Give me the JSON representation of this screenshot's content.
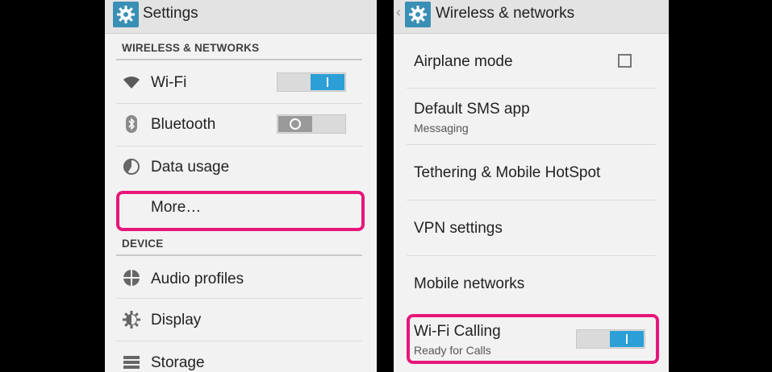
{
  "colors": {
    "accent": "#2b9fd6",
    "highlight": "#e6177a",
    "actionbar_icon_bg": "#3a8fb5"
  },
  "left": {
    "title": "Settings",
    "title_icon": "gear-icon",
    "sections": {
      "wireless": "WIRELESS & NETWORKS",
      "device": "DEVICE"
    },
    "items": {
      "wifi": {
        "label": "Wi-Fi",
        "icon": "wifi-icon",
        "toggle": "on"
      },
      "bluetooth": {
        "label": "Bluetooth",
        "icon": "bluetooth-icon",
        "toggle": "off"
      },
      "data_usage": {
        "label": "Data usage",
        "icon": "data-usage-icon"
      },
      "more": {
        "label": "More…",
        "highlighted": true
      },
      "audio": {
        "label": "Audio profiles",
        "icon": "audio-profiles-icon"
      },
      "display": {
        "label": "Display",
        "icon": "display-brightness-icon"
      },
      "storage": {
        "label": "Storage",
        "icon": "storage-icon"
      }
    }
  },
  "right": {
    "title": "Wireless & networks",
    "title_icon": "gear-icon",
    "back_icon": "back-chevron-icon",
    "items": {
      "airplane": {
        "label": "Airplane mode",
        "checked": false
      },
      "sms": {
        "label": "Default SMS app",
        "sub": "Messaging"
      },
      "tethering": {
        "label": "Tethering & Mobile HotSpot"
      },
      "vpn": {
        "label": "VPN settings"
      },
      "mobile": {
        "label": "Mobile networks"
      },
      "wifi_calling": {
        "label": "Wi-Fi Calling",
        "sub": "Ready for Calls",
        "toggle": "on",
        "highlighted": true
      }
    }
  }
}
